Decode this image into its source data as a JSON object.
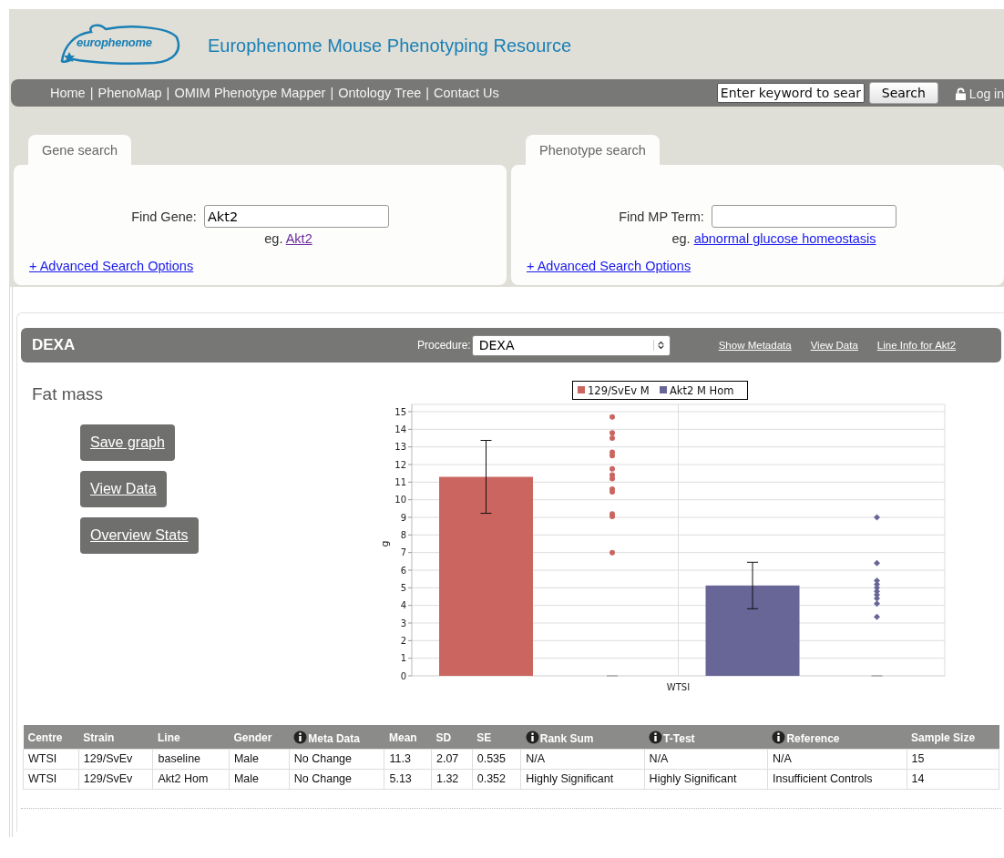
{
  "header": {
    "logo_text": "europhenome",
    "title": "Europhenome Mouse Phenotyping Resource"
  },
  "nav": {
    "separator": "|",
    "links": [
      "Home",
      "PhenoMap",
      "OMIM Phenotype Mapper",
      "Ontology Tree",
      "Contact Us"
    ],
    "search": {
      "placeholder": "Enter keyword to sear",
      "button": "Search"
    },
    "login": "Log in"
  },
  "search_panels": [
    {
      "tab": "Gene search",
      "label": "Find Gene:",
      "value": "Akt2",
      "example_prefix": "eg.",
      "example_link": "Akt2",
      "example_visited": true,
      "advanced": "+ Advanced Search Options"
    },
    {
      "tab": "Phenotype search",
      "label": "Find MP Term:",
      "example_prefix": "eg.",
      "example_link": "abnormal glucose homeostasis",
      "example_visited": false,
      "advanced": "+ Advanced Search Options"
    }
  ],
  "procedure_bar": {
    "title": "DEXA",
    "procedure_label": "Procedure:",
    "procedure_value": "DEXA",
    "links": [
      "Show Metadata",
      "View Data",
      "Line Info for Akt2"
    ]
  },
  "parameter": {
    "title": "Fat mass",
    "buttons": [
      "Save graph",
      "View Data",
      "Overview Stats"
    ]
  },
  "chart_data": {
    "type": "bar",
    "categories": [
      "WTSI"
    ],
    "ylabel": "g",
    "ylim": [
      0,
      15
    ],
    "yticks": [
      0,
      1,
      2,
      3,
      4,
      5,
      6,
      7,
      8,
      9,
      10,
      11,
      12,
      13,
      14,
      15
    ],
    "grid": true,
    "legend": true,
    "series": [
      {
        "name": "129/SvEv M",
        "color": "#cb6560",
        "values": [
          11.3
        ],
        "errors": [
          2.07
        ]
      },
      {
        "name": "Akt2 M Hom",
        "color": "#686597",
        "values": [
          5.13
        ],
        "errors": [
          1.32
        ]
      },
      {
        "type": "scatter",
        "color": "#cb6560",
        "marker": "circle",
        "x": [
          "WTSI",
          "WTSI",
          "WTSI",
          "WTSI",
          "WTSI",
          "WTSI",
          "WTSI",
          "WTSI",
          "WTSI",
          "WTSI",
          "WTSI",
          "WTSI",
          "WTSI"
        ],
        "values": [
          14.7,
          13.8,
          13.5,
          12.7,
          12.5,
          11.75,
          11.4,
          11.2,
          10.6,
          10.45,
          9.2,
          9.05,
          7.0
        ]
      },
      {
        "type": "scatter",
        "color": "#686597",
        "marker": "diamond",
        "x": [
          "WTSI",
          "WTSI",
          "WTSI",
          "WTSI",
          "WTSI",
          "WTSI",
          "WTSI",
          "WTSI",
          "WTSI",
          "WTSI"
        ],
        "values": [
          9.0,
          6.4,
          5.4,
          5.2,
          5.0,
          4.8,
          4.6,
          4.4,
          4.1,
          3.35
        ]
      }
    ]
  },
  "table": {
    "columns": [
      {
        "label": "Centre",
        "info": false
      },
      {
        "label": "Strain",
        "info": false
      },
      {
        "label": "Line",
        "info": false
      },
      {
        "label": "Gender",
        "info": false
      },
      {
        "label": "Meta Data",
        "info": true
      },
      {
        "label": "Mean",
        "info": false
      },
      {
        "label": "SD",
        "info": false
      },
      {
        "label": "SE",
        "info": false
      },
      {
        "label": "Rank Sum",
        "info": true
      },
      {
        "label": "T-Test",
        "info": true
      },
      {
        "label": "Reference",
        "info": true
      },
      {
        "label": "Sample Size",
        "info": false
      }
    ],
    "rows": [
      [
        "WTSI",
        "129/SvEv",
        "baseline",
        "Male",
        "No Change",
        "11.3",
        "2.07",
        "0.535",
        "N/A",
        "N/A",
        "N/A",
        "15"
      ],
      [
        "WTSI",
        "129/SvEv",
        "Akt2 Hom",
        "Male",
        "No Change",
        "5.13",
        "1.32",
        "0.352",
        "Highly Significant",
        "Highly Significant",
        "Insufficient Controls",
        "14"
      ]
    ]
  }
}
